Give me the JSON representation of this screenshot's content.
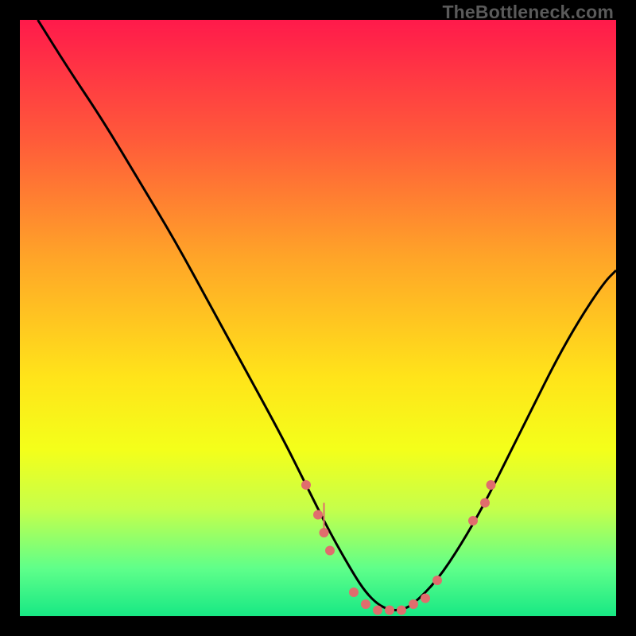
{
  "watermark": "TheBottleneck.com",
  "chart_data": {
    "type": "line",
    "title": "",
    "xlabel": "",
    "ylabel": "",
    "xlim": [
      0,
      100
    ],
    "ylim": [
      0,
      100
    ],
    "background_gradient": {
      "stops": [
        {
          "offset": 0.0,
          "color": "#ff1a4b"
        },
        {
          "offset": 0.2,
          "color": "#ff5a3a"
        },
        {
          "offset": 0.4,
          "color": "#ffa528"
        },
        {
          "offset": 0.6,
          "color": "#ffe41a"
        },
        {
          "offset": 0.72,
          "color": "#f4ff1a"
        },
        {
          "offset": 0.82,
          "color": "#c6ff4a"
        },
        {
          "offset": 0.92,
          "color": "#5fff8a"
        },
        {
          "offset": 1.0,
          "color": "#17e884"
        }
      ]
    },
    "series": [
      {
        "name": "bottleneck-curve",
        "color": "#000000",
        "x": [
          3,
          8,
          14,
          20,
          26,
          32,
          38,
          44,
          48,
          52,
          56,
          58,
          60,
          62,
          64,
          66,
          70,
          74,
          78,
          82,
          86,
          90,
          94,
          98,
          100
        ],
        "y": [
          100,
          92,
          83,
          73,
          63,
          52,
          41,
          30,
          22,
          14,
          7,
          4,
          2,
          1,
          1,
          2,
          6,
          12,
          19,
          27,
          35,
          43,
          50,
          56,
          58
        ]
      }
    ],
    "markers": {
      "name": "highlight-points",
      "color": "#e06d6d",
      "radius": 6,
      "points": [
        {
          "x": 48,
          "y": 22
        },
        {
          "x": 50,
          "y": 17
        },
        {
          "x": 51,
          "y": 14
        },
        {
          "x": 52,
          "y": 11
        },
        {
          "x": 56,
          "y": 4
        },
        {
          "x": 58,
          "y": 2
        },
        {
          "x": 60,
          "y": 1
        },
        {
          "x": 62,
          "y": 1
        },
        {
          "x": 64,
          "y": 1
        },
        {
          "x": 66,
          "y": 2
        },
        {
          "x": 68,
          "y": 3
        },
        {
          "x": 70,
          "y": 6
        },
        {
          "x": 76,
          "y": 16
        },
        {
          "x": 78,
          "y": 19
        },
        {
          "x": 79,
          "y": 22
        }
      ]
    },
    "vertical_accent": {
      "x": 51,
      "y_top": 14,
      "y_bottom": 19,
      "color": "#e06d6d",
      "width": 2
    }
  }
}
